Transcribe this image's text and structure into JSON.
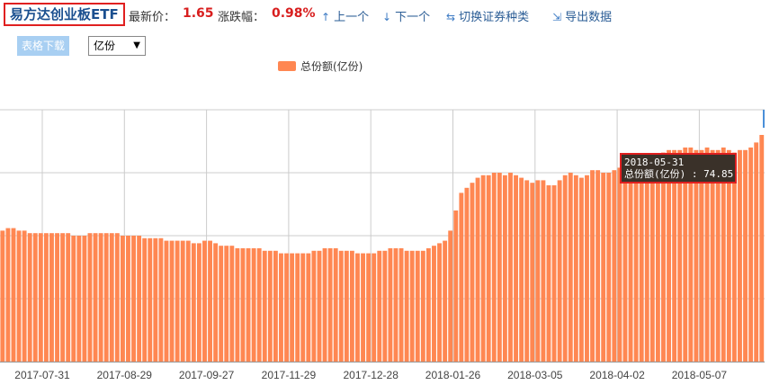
{
  "toolbar": {
    "fund_name": "易方达创业板ETF",
    "price_label": "最新价：",
    "price_value": "1.65",
    "change_label": "涨跌幅：",
    "change_value": "0.98%",
    "prev_label": "上一个",
    "next_label": "下一个",
    "switch_label": "切换证券种类",
    "export_label": "导出数据"
  },
  "controls": {
    "table_download": "表格下载",
    "unit_selected": "亿份"
  },
  "tooltip": {
    "date": "2018-05-31",
    "text": "总份额(亿份) : 74.85"
  },
  "colors": {
    "bar": "#ff8752",
    "accent_red": "#d81e1e",
    "grid": "#cccccc"
  },
  "chart_data": {
    "type": "bar",
    "title": "",
    "legend": "总份额(亿份)",
    "legend_position": "top-center",
    "xlabel": "",
    "ylabel": "",
    "grid": true,
    "x_tick_labels": [
      "2017-07-31",
      "2017-08-29",
      "2017-09-27",
      "2017-11-29",
      "2017-12-28",
      "2018-01-26",
      "2018-03-05",
      "2018-04-02",
      "2018-05-07"
    ],
    "ylim": [
      0,
      100
    ],
    "values": [
      52,
      53,
      53,
      52,
      52,
      51,
      51,
      51,
      51,
      51,
      51,
      51,
      51,
      50,
      50,
      50,
      51,
      51,
      51,
      51,
      51,
      51,
      50,
      50,
      50,
      50,
      49,
      49,
      49,
      49,
      48,
      48,
      48,
      48,
      48,
      47,
      47,
      48,
      48,
      47,
      46,
      46,
      46,
      45,
      45,
      45,
      45,
      45,
      44,
      44,
      44,
      43,
      43,
      43,
      43,
      43,
      43,
      44,
      44,
      45,
      45,
      45,
      44,
      44,
      44,
      43,
      43,
      43,
      43,
      44,
      44,
      45,
      45,
      45,
      44,
      44,
      44,
      44,
      45,
      46,
      47,
      48,
      52,
      60,
      67,
      69,
      71,
      73,
      74,
      74,
      75,
      75,
      74,
      75,
      74,
      73,
      72,
      71,
      72,
      72,
      70,
      70,
      72,
      74,
      75,
      74,
      73,
      74,
      76,
      76,
      75,
      75,
      76,
      77,
      78,
      79,
      80,
      80,
      81,
      81,
      82,
      83,
      84,
      84,
      84,
      85,
      85,
      84,
      84,
      85,
      84,
      84,
      85,
      84,
      83,
      84,
      84,
      85,
      87,
      90
    ]
  }
}
